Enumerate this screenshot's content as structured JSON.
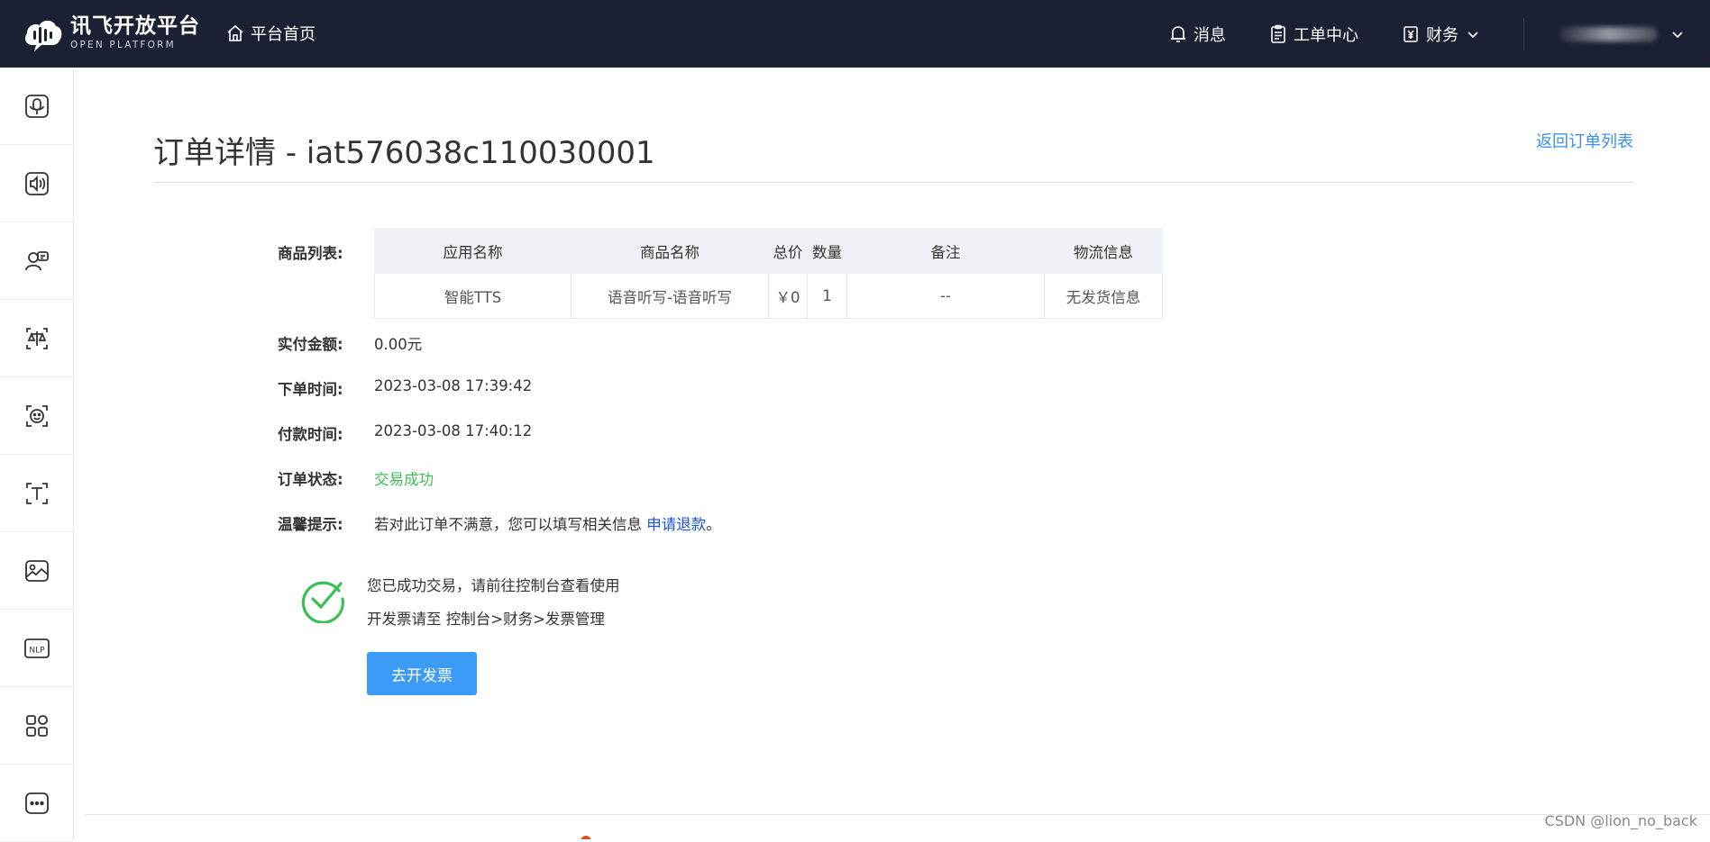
{
  "topbar": {
    "logo_cn": "讯飞开放平台",
    "logo_en": "OPEN PLATFORM",
    "home_label": "平台首页",
    "messages_label": "消息",
    "tickets_label": "工单中心",
    "finance_label": "财务"
  },
  "page": {
    "title": "订单详情 - iat576038c110030001",
    "back_link": "返回订单列表"
  },
  "order": {
    "goods_label": "商品列表:",
    "columns": [
      "应用名称",
      "商品名称",
      "总价",
      "数量",
      "备注",
      "物流信息"
    ],
    "row": [
      "智能TTS",
      "语音听写-语音听写",
      "￥0",
      "1",
      "--",
      "无发货信息"
    ],
    "paid_label": "实付金额:",
    "paid_value": "0.00元",
    "order_time_label": "下单时间:",
    "order_time_value": "2023-03-08 17:39:42",
    "pay_time_label": "付款时间:",
    "pay_time_value": "2023-03-08 17:40:12",
    "status_label": "订单状态:",
    "status_value": "交易成功",
    "tip_label": "温馨提示:",
    "tip_text": "若对此订单不满意，您可以填写相关信息 ",
    "tip_link": "申请退款",
    "tip_end": "。"
  },
  "success": {
    "line1": "您已成功交易，请前往控制台查看使用",
    "line2": "开发票请至 控制台>财务>发票管理",
    "button": "去开发票"
  },
  "watermark": "CSDN @lion_no_back",
  "colors": {
    "topbar": "#1b2033",
    "accent": "#3d9bf8",
    "success": "#3bbf55"
  }
}
